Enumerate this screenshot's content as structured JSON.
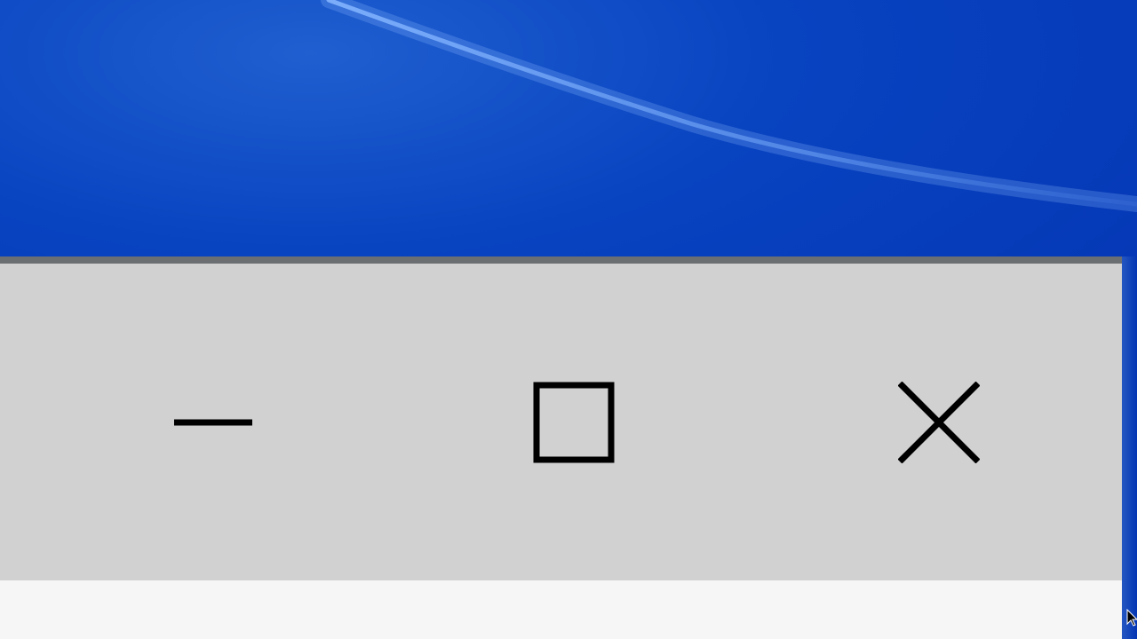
{
  "desktop": {
    "wallpaper": "windows-10-blue",
    "colors": {
      "base": "#0436b4",
      "highlight": "#1f5fd0",
      "streak": "#7fb2ff"
    }
  },
  "window": {
    "titlebar_color": "#d1d1d1",
    "border_color": "#6c6f72",
    "client_color": "#f6f6f6",
    "caption_buttons": {
      "minimize": {
        "icon": "minimize-icon",
        "glyph": "—"
      },
      "maximize": {
        "icon": "maximize-icon",
        "glyph": "☐"
      },
      "close": {
        "icon": "close-icon",
        "glyph": "✕"
      }
    }
  }
}
